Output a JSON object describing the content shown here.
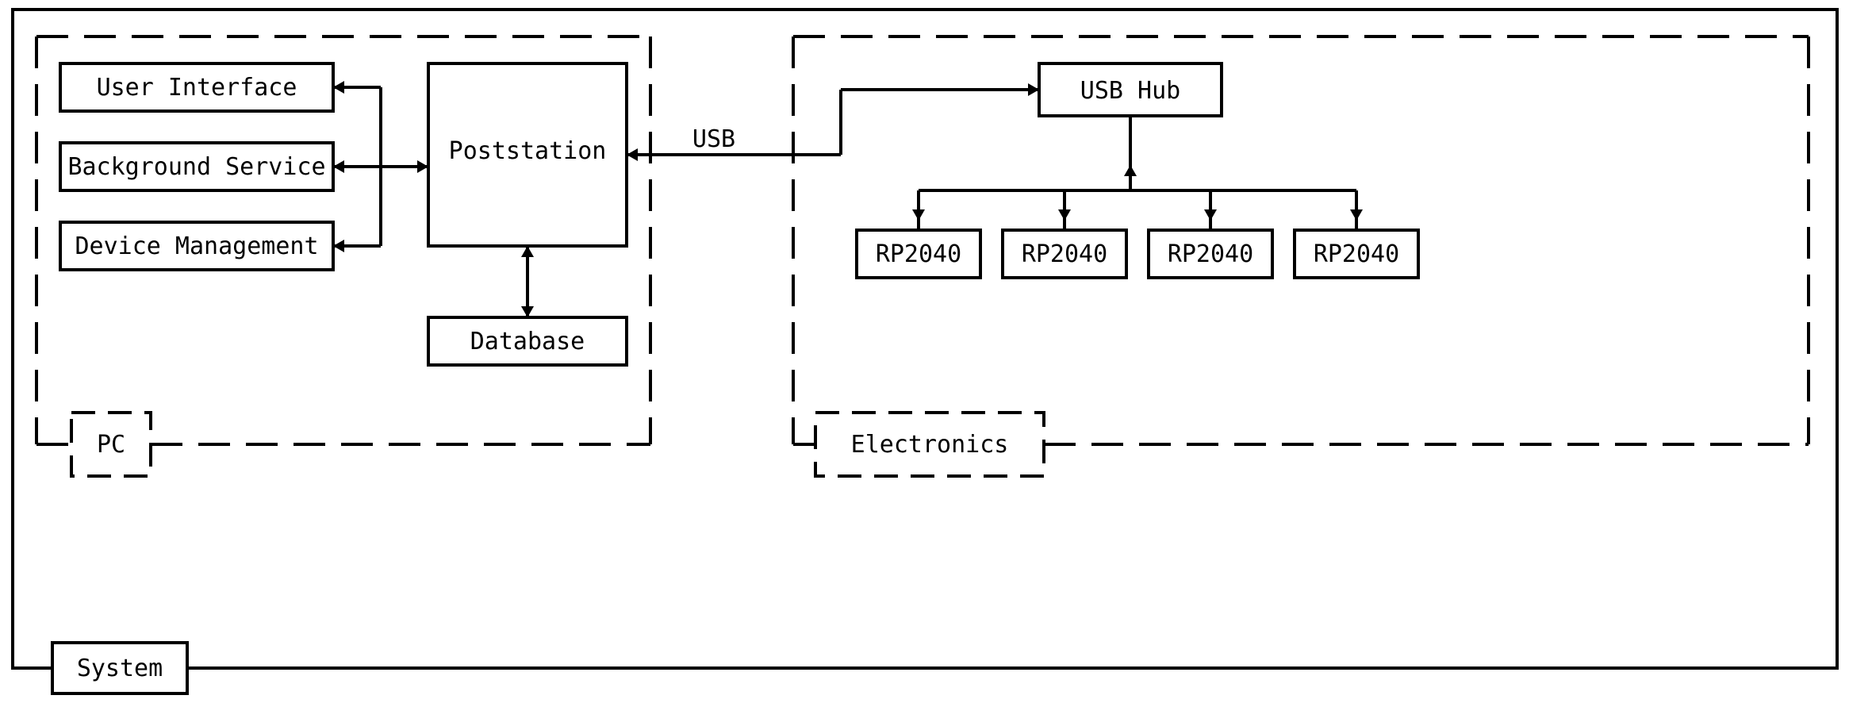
{
  "outer": {
    "label": "System"
  },
  "pc": {
    "label": "PC",
    "modules": {
      "ui": "User Interface",
      "bg": "Background Service",
      "dev": "Device Management"
    },
    "hub": "Poststation",
    "db": "Database"
  },
  "link": {
    "label": "USB"
  },
  "electronics": {
    "label": "Electronics",
    "hub": "USB Hub",
    "devices": [
      "RP2040",
      "RP2040",
      "RP2040",
      "RP2040"
    ]
  }
}
